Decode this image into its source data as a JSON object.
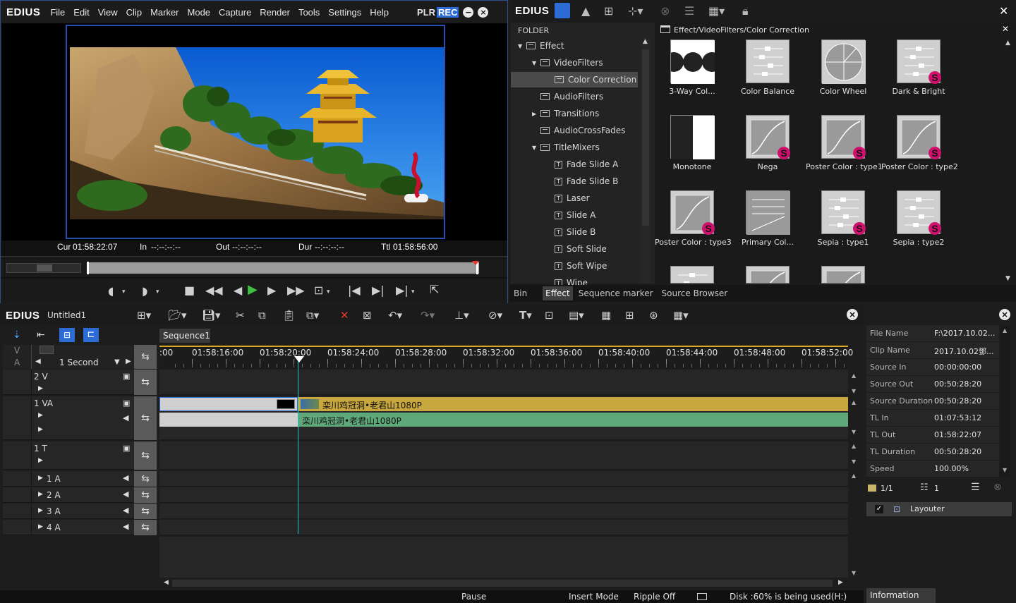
{
  "app": {
    "logo": "EDIUS"
  },
  "player": {
    "menu": [
      "File",
      "Edit",
      "View",
      "Clip",
      "Marker",
      "Mode",
      "Capture",
      "Render",
      "Tools",
      "Settings",
      "Help"
    ],
    "plr": "PLR",
    "rec": "REC",
    "timecodes": {
      "cur_label": "Cur",
      "cur": "01:58:22:07",
      "in_label": "In",
      "in": "--:--:--:--",
      "out_label": "Out",
      "out": "--:--:--:--",
      "dur_label": "Dur",
      "dur": "--:--:--:--",
      "ttl_label": "Ttl",
      "ttl": "01:58:56:00"
    }
  },
  "effect": {
    "logo": "EDIUS",
    "folder_header": "FOLDER",
    "path": "Effect/VideoFilters/Color Correction",
    "tree": [
      {
        "label": "Effect",
        "indent": 0,
        "arrow": "▼",
        "icon": "folder"
      },
      {
        "label": "VideoFilters",
        "indent": 1,
        "arrow": "▼",
        "icon": "folder"
      },
      {
        "label": "Color Correction",
        "indent": 2,
        "arrow": "",
        "icon": "folder",
        "selected": true
      },
      {
        "label": "AudioFilters",
        "indent": 1,
        "arrow": "",
        "icon": "folder"
      },
      {
        "label": "Transitions",
        "indent": 1,
        "arrow": "▶",
        "icon": "folder"
      },
      {
        "label": "AudioCrossFades",
        "indent": 1,
        "arrow": "",
        "icon": "folder"
      },
      {
        "label": "TitleMixers",
        "indent": 1,
        "arrow": "▼",
        "icon": "folder"
      },
      {
        "label": "Fade Slide A",
        "indent": 2,
        "arrow": "",
        "icon": "title"
      },
      {
        "label": "Fade Slide B",
        "indent": 2,
        "arrow": "",
        "icon": "title"
      },
      {
        "label": "Laser",
        "indent": 2,
        "arrow": "",
        "icon": "title"
      },
      {
        "label": "Slide A",
        "indent": 2,
        "arrow": "",
        "icon": "title"
      },
      {
        "label": "Slide B",
        "indent": 2,
        "arrow": "",
        "icon": "title"
      },
      {
        "label": "Soft Slide",
        "indent": 2,
        "arrow": "",
        "icon": "title"
      },
      {
        "label": "Soft Wipe",
        "indent": 2,
        "arrow": "",
        "icon": "title"
      },
      {
        "label": "Wipe",
        "indent": 2,
        "arrow": "",
        "icon": "title"
      }
    ],
    "items": [
      {
        "label": "3-Way Col...",
        "kind": "threeway",
        "s": false
      },
      {
        "label": "Color Balance",
        "kind": "sliders",
        "s": false
      },
      {
        "label": "Color Wheel",
        "kind": "wheel",
        "s": false
      },
      {
        "label": "Dark & Bright",
        "kind": "sliders",
        "s": true
      },
      {
        "label": "Monotone",
        "kind": "mono",
        "s": false
      },
      {
        "label": "Nega",
        "kind": "curve",
        "s": true
      },
      {
        "label": "Poster Color : type1",
        "kind": "curve",
        "s": true
      },
      {
        "label": "Poster Color : type2",
        "kind": "curve",
        "s": true
      },
      {
        "label": "Poster Color : type3",
        "kind": "curve",
        "s": true
      },
      {
        "label": "Primary Col...",
        "kind": "primary",
        "s": false
      },
      {
        "label": "Sepia : type1",
        "kind": "sliders",
        "s": true
      },
      {
        "label": "Sepia : type2",
        "kind": "sliders",
        "s": true
      }
    ],
    "tabs": [
      "Bin",
      "Effect",
      "Sequence marker",
      "Source Browser"
    ],
    "active_tab": "Effect"
  },
  "timeline": {
    "logo": "EDIUS",
    "project": "Untitled1",
    "sequence_tab": "Sequence1",
    "scale": "1 Second",
    "ruler": [
      ":00",
      "01:58:16:00",
      "01:58:20:00",
      "01:58:24:00",
      "01:58:28:00",
      "01:58:32:00",
      "01:58:36:00",
      "01:58:40:00",
      "01:58:44:00",
      "01:58:48:00",
      "01:58:52:00"
    ],
    "header_v": "V",
    "header_a": "A",
    "tracks": [
      {
        "label": "2 V"
      },
      {
        "label": "1 VA"
      },
      {
        "label": "1 T"
      },
      {
        "label": "1 A"
      },
      {
        "label": "2 A"
      },
      {
        "label": "3 A"
      },
      {
        "label": "4 A"
      }
    ],
    "clip_video": "栾川鸡冠洞•老君山1080P",
    "clip_audio": "栾川鸡冠洞•老君山1080P"
  },
  "status": {
    "pause": "Pause",
    "insert": "Insert Mode",
    "ripple": "Ripple Off",
    "disk": "Disk :60% is being used(H:)"
  },
  "info": {
    "rows": [
      {
        "k": "File Name",
        "v": "F:\\2017.10.02..."
      },
      {
        "k": "Clip Name",
        "v": "2017.10.02鄧..."
      },
      {
        "k": "Source In",
        "v": "00:00:00:00"
      },
      {
        "k": "Source Out",
        "v": "00:50:28:20"
      },
      {
        "k": "Source Duration",
        "v": "00:50:28:20"
      },
      {
        "k": "TL In",
        "v": "01:07:53:12"
      },
      {
        "k": "TL Out",
        "v": "01:58:22:07"
      },
      {
        "k": "TL Duration",
        "v": "00:50:28:20"
      },
      {
        "k": "Speed",
        "v": "100.00%"
      }
    ],
    "page": "1/1",
    "count": "1",
    "layouter": "Layouter",
    "tab": "Information"
  }
}
